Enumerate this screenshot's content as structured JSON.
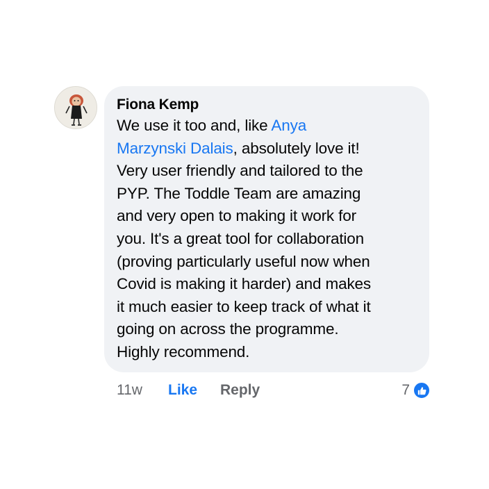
{
  "comment": {
    "author": "Fiona Kemp",
    "text_before_mention": "We use it too and, like ",
    "mention": "Anya\nMarzynski Dalais",
    "text_after_mention": ", absolutely love it!\nVery user friendly and tailored to the\nPYP. The Toddle Team are amazing\nand very open to making it work for\nyou. It's a great tool for collaboration\n(proving particularly useful now when\nCovid is making it harder) and makes\nit much easier to keep track of what it\ngoing on across the programme.\nHighly recommend.",
    "timestamp": "11w",
    "like_label": "Like",
    "reply_label": "Reply",
    "reaction_count": "7",
    "reaction_icon": "thumbs-up-icon"
  },
  "colors": {
    "bubble_bg": "#f0f2f5",
    "link_blue": "#1877f2",
    "meta_gray": "#65676b"
  }
}
